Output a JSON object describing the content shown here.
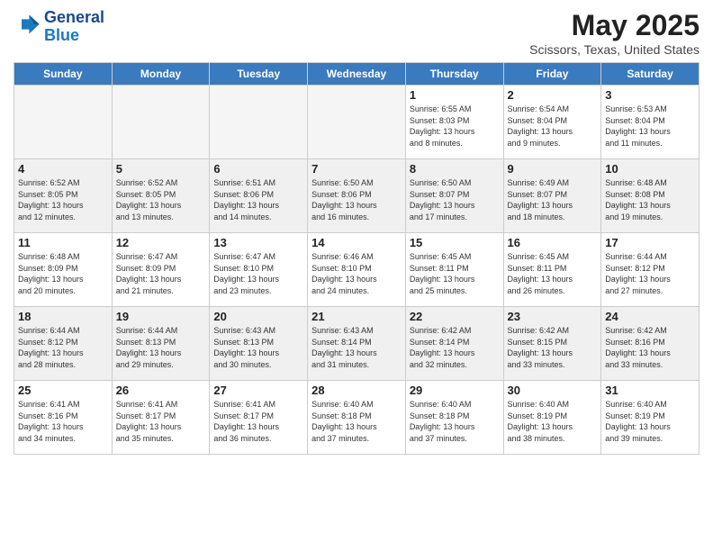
{
  "header": {
    "logo_line1": "General",
    "logo_line2": "Blue",
    "month": "May 2025",
    "location": "Scissors, Texas, United States"
  },
  "days_of_week": [
    "Sunday",
    "Monday",
    "Tuesday",
    "Wednesday",
    "Thursday",
    "Friday",
    "Saturday"
  ],
  "weeks": [
    [
      {
        "day": "",
        "info": ""
      },
      {
        "day": "",
        "info": ""
      },
      {
        "day": "",
        "info": ""
      },
      {
        "day": "",
        "info": ""
      },
      {
        "day": "1",
        "info": "Sunrise: 6:55 AM\nSunset: 8:03 PM\nDaylight: 13 hours\nand 8 minutes."
      },
      {
        "day": "2",
        "info": "Sunrise: 6:54 AM\nSunset: 8:04 PM\nDaylight: 13 hours\nand 9 minutes."
      },
      {
        "day": "3",
        "info": "Sunrise: 6:53 AM\nSunset: 8:04 PM\nDaylight: 13 hours\nand 11 minutes."
      }
    ],
    [
      {
        "day": "4",
        "info": "Sunrise: 6:52 AM\nSunset: 8:05 PM\nDaylight: 13 hours\nand 12 minutes."
      },
      {
        "day": "5",
        "info": "Sunrise: 6:52 AM\nSunset: 8:05 PM\nDaylight: 13 hours\nand 13 minutes."
      },
      {
        "day": "6",
        "info": "Sunrise: 6:51 AM\nSunset: 8:06 PM\nDaylight: 13 hours\nand 14 minutes."
      },
      {
        "day": "7",
        "info": "Sunrise: 6:50 AM\nSunset: 8:06 PM\nDaylight: 13 hours\nand 16 minutes."
      },
      {
        "day": "8",
        "info": "Sunrise: 6:50 AM\nSunset: 8:07 PM\nDaylight: 13 hours\nand 17 minutes."
      },
      {
        "day": "9",
        "info": "Sunrise: 6:49 AM\nSunset: 8:07 PM\nDaylight: 13 hours\nand 18 minutes."
      },
      {
        "day": "10",
        "info": "Sunrise: 6:48 AM\nSunset: 8:08 PM\nDaylight: 13 hours\nand 19 minutes."
      }
    ],
    [
      {
        "day": "11",
        "info": "Sunrise: 6:48 AM\nSunset: 8:09 PM\nDaylight: 13 hours\nand 20 minutes."
      },
      {
        "day": "12",
        "info": "Sunrise: 6:47 AM\nSunset: 8:09 PM\nDaylight: 13 hours\nand 21 minutes."
      },
      {
        "day": "13",
        "info": "Sunrise: 6:47 AM\nSunset: 8:10 PM\nDaylight: 13 hours\nand 23 minutes."
      },
      {
        "day": "14",
        "info": "Sunrise: 6:46 AM\nSunset: 8:10 PM\nDaylight: 13 hours\nand 24 minutes."
      },
      {
        "day": "15",
        "info": "Sunrise: 6:45 AM\nSunset: 8:11 PM\nDaylight: 13 hours\nand 25 minutes."
      },
      {
        "day": "16",
        "info": "Sunrise: 6:45 AM\nSunset: 8:11 PM\nDaylight: 13 hours\nand 26 minutes."
      },
      {
        "day": "17",
        "info": "Sunrise: 6:44 AM\nSunset: 8:12 PM\nDaylight: 13 hours\nand 27 minutes."
      }
    ],
    [
      {
        "day": "18",
        "info": "Sunrise: 6:44 AM\nSunset: 8:12 PM\nDaylight: 13 hours\nand 28 minutes."
      },
      {
        "day": "19",
        "info": "Sunrise: 6:44 AM\nSunset: 8:13 PM\nDaylight: 13 hours\nand 29 minutes."
      },
      {
        "day": "20",
        "info": "Sunrise: 6:43 AM\nSunset: 8:13 PM\nDaylight: 13 hours\nand 30 minutes."
      },
      {
        "day": "21",
        "info": "Sunrise: 6:43 AM\nSunset: 8:14 PM\nDaylight: 13 hours\nand 31 minutes."
      },
      {
        "day": "22",
        "info": "Sunrise: 6:42 AM\nSunset: 8:14 PM\nDaylight: 13 hours\nand 32 minutes."
      },
      {
        "day": "23",
        "info": "Sunrise: 6:42 AM\nSunset: 8:15 PM\nDaylight: 13 hours\nand 33 minutes."
      },
      {
        "day": "24",
        "info": "Sunrise: 6:42 AM\nSunset: 8:16 PM\nDaylight: 13 hours\nand 33 minutes."
      }
    ],
    [
      {
        "day": "25",
        "info": "Sunrise: 6:41 AM\nSunset: 8:16 PM\nDaylight: 13 hours\nand 34 minutes."
      },
      {
        "day": "26",
        "info": "Sunrise: 6:41 AM\nSunset: 8:17 PM\nDaylight: 13 hours\nand 35 minutes."
      },
      {
        "day": "27",
        "info": "Sunrise: 6:41 AM\nSunset: 8:17 PM\nDaylight: 13 hours\nand 36 minutes."
      },
      {
        "day": "28",
        "info": "Sunrise: 6:40 AM\nSunset: 8:18 PM\nDaylight: 13 hours\nand 37 minutes."
      },
      {
        "day": "29",
        "info": "Sunrise: 6:40 AM\nSunset: 8:18 PM\nDaylight: 13 hours\nand 37 minutes."
      },
      {
        "day": "30",
        "info": "Sunrise: 6:40 AM\nSunset: 8:19 PM\nDaylight: 13 hours\nand 38 minutes."
      },
      {
        "day": "31",
        "info": "Sunrise: 6:40 AM\nSunset: 8:19 PM\nDaylight: 13 hours\nand 39 minutes."
      }
    ]
  ]
}
